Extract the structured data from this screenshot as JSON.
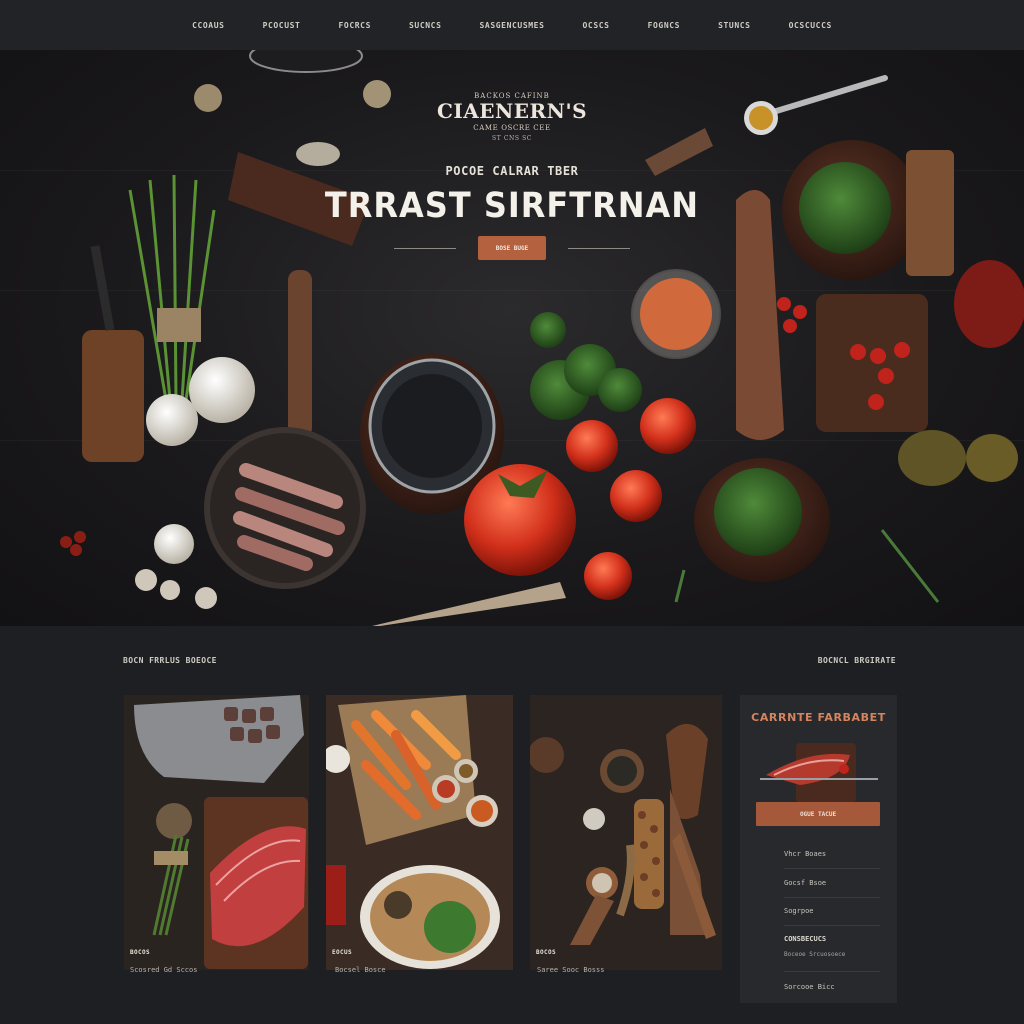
{
  "nav": {
    "items": [
      "CCOAUS",
      "PCOCUST",
      "FOCRCS",
      "SUCNCS",
      "SASGENCUSMES",
      "OCSCS",
      "FOGNCS",
      "STUNCS",
      "OCSCUCCS"
    ]
  },
  "hero": {
    "brand_top": "BACKOS CAFINB",
    "brand_logo": "CIAENERN'S",
    "brand_sub": "CAME OSCRE CEE",
    "brand_sub2": "ST  CNS SC",
    "tagline": "POCOE CALRAR TBER",
    "title": "TRRAST SIRFTRNAN",
    "cta_label": "BOSE BUGE"
  },
  "section": {
    "left_label": "BOCN FRRLUS  BOEOCE",
    "right_label": "BOCNCL BRGIRATE"
  },
  "cards": [
    {
      "label": "BOCOS",
      "caption": "Scosred Gd Sccos"
    },
    {
      "label": "EOCUS",
      "caption": "Bocsel Bosce"
    },
    {
      "label": "BOCOS",
      "caption": "Saree Sooc Bosss"
    }
  ],
  "panel": {
    "title": "CARRNTE FARBABET",
    "button_label": "OGUE TACUE",
    "links": [
      "Vhcr Boaes",
      "Gocsf Bsoe",
      "Sogrpoe",
      "CONSBECUCS",
      "Boceoe Srcuosoece",
      "Sorcooe Bicc"
    ]
  },
  "colors": {
    "background": "#1e1f22",
    "accent": "#b4613f",
    "panel_title": "#d4845f"
  }
}
